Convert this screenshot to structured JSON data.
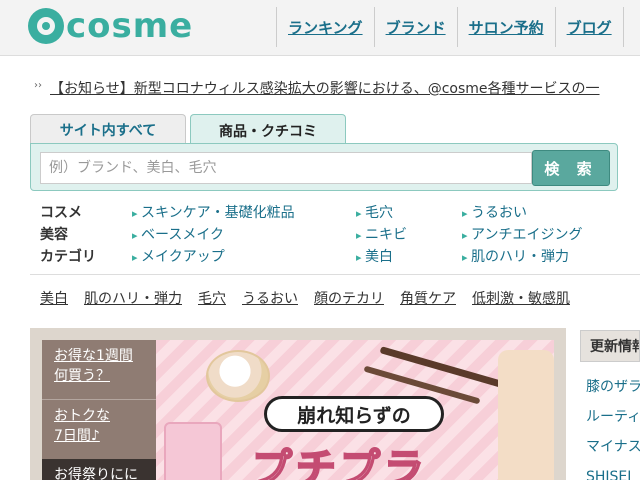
{
  "brand": {
    "logo_text": "cosme"
  },
  "nav": [
    "ランキング",
    "ブランド",
    "サロン予約",
    "ブログ"
  ],
  "news": {
    "text": "【お知らせ】新型コロナウィルス感染拡大の影響における、@cosme各種サービスの一"
  },
  "search": {
    "tab_all": "サイト内すべて",
    "tab_product": "商品・クチコミ",
    "placeholder": "例）ブランド、美白、毛穴",
    "button": "検 索"
  },
  "categories": {
    "label": [
      "コスメ",
      "美容",
      "カテゴリ"
    ],
    "col1": [
      "スキンケア・基礎化粧品",
      "ベースメイク",
      "メイクアップ"
    ],
    "col2": [
      "毛穴",
      "ニキビ",
      "美白"
    ],
    "col3": [
      "うるおい",
      "アンチエイジング",
      "肌のハリ・弾力"
    ]
  },
  "tags": [
    "美白",
    "肌のハリ・弾力",
    "毛穴",
    "うるおい",
    "顔のテカリ",
    "角質ケア",
    "低刺激・敏感肌"
  ],
  "promo": {
    "side": [
      "お得な1週間\n何買う？",
      "おトクな\n7日間♪",
      "お得祭りにに"
    ],
    "side1_l1": "お得な1週間",
    "side1_l2": "何買う？",
    "side2_l1": "おトクな",
    "side2_l2": "7日間♪",
    "side3": "お得祭りにに",
    "banner_title": "崩れ知らずの",
    "banner_sub": "プチプラ"
  },
  "updates": {
    "heading": "更新情報",
    "items": [
      "膝のザラ",
      "ルーティ",
      "マイナス",
      "SHISEI"
    ]
  }
}
